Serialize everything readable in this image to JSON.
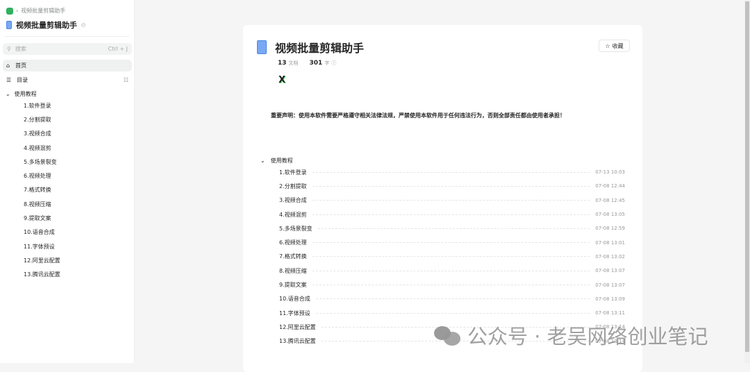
{
  "sidebar": {
    "breadcrumb": "视频批量剪辑助手",
    "book_title": "视频批量剪辑助手",
    "search_placeholder": "搜索",
    "search_shortcut": "Ctrl + J",
    "home": "首页",
    "toc": "目录",
    "group": "使用教程",
    "items": [
      "1.软件登录",
      "2.分割提取",
      "3.视频合成",
      "4.视频混剪",
      "5.多场景裂变",
      "6.视频处理",
      "7.格式转换",
      "8.视频压缩",
      "9.提取文案",
      "10.语音合成",
      "11.字体预设",
      "12.阿里云配置",
      "13.腾讯云配置"
    ]
  },
  "main": {
    "title": "视频批量剪辑助手",
    "favorite": "收藏",
    "doc_count": "13",
    "doc_label": "文档",
    "word_count": "301",
    "word_label": "字",
    "notice": "重要声明：使用本软件需要严格遵守相关法律法规，严禁使用本软件用于任何违法行为，否则全部责任都由使用者承担！",
    "group": "使用教程",
    "docs": [
      {
        "t": "1.软件登录",
        "d": "07-13 10:03"
      },
      {
        "t": "2.分割提取",
        "d": "07-08 12:44"
      },
      {
        "t": "3.视频合成",
        "d": "07-08 12:45"
      },
      {
        "t": "4.视频混剪",
        "d": "07-08 13:05"
      },
      {
        "t": "5.多场景裂变",
        "d": "07-08 12:59"
      },
      {
        "t": "6.视频处理",
        "d": "07-08 13:01"
      },
      {
        "t": "7.格式转换",
        "d": "07-08 13:02"
      },
      {
        "t": "8.视频压缩",
        "d": "07-08 13:07"
      },
      {
        "t": "9.提取文案",
        "d": "07-08 13:07"
      },
      {
        "t": "10.语音合成",
        "d": "07-08 13:09"
      },
      {
        "t": "11.字体预设",
        "d": "07-08 13:11"
      },
      {
        "t": "12.阿里云配置",
        "d": "07-08 13:14"
      },
      {
        "t": "13.腾讯云配置",
        "d": "07-08 13:14"
      }
    ]
  },
  "watermark": "公众号 · 老吴网络创业笔记"
}
